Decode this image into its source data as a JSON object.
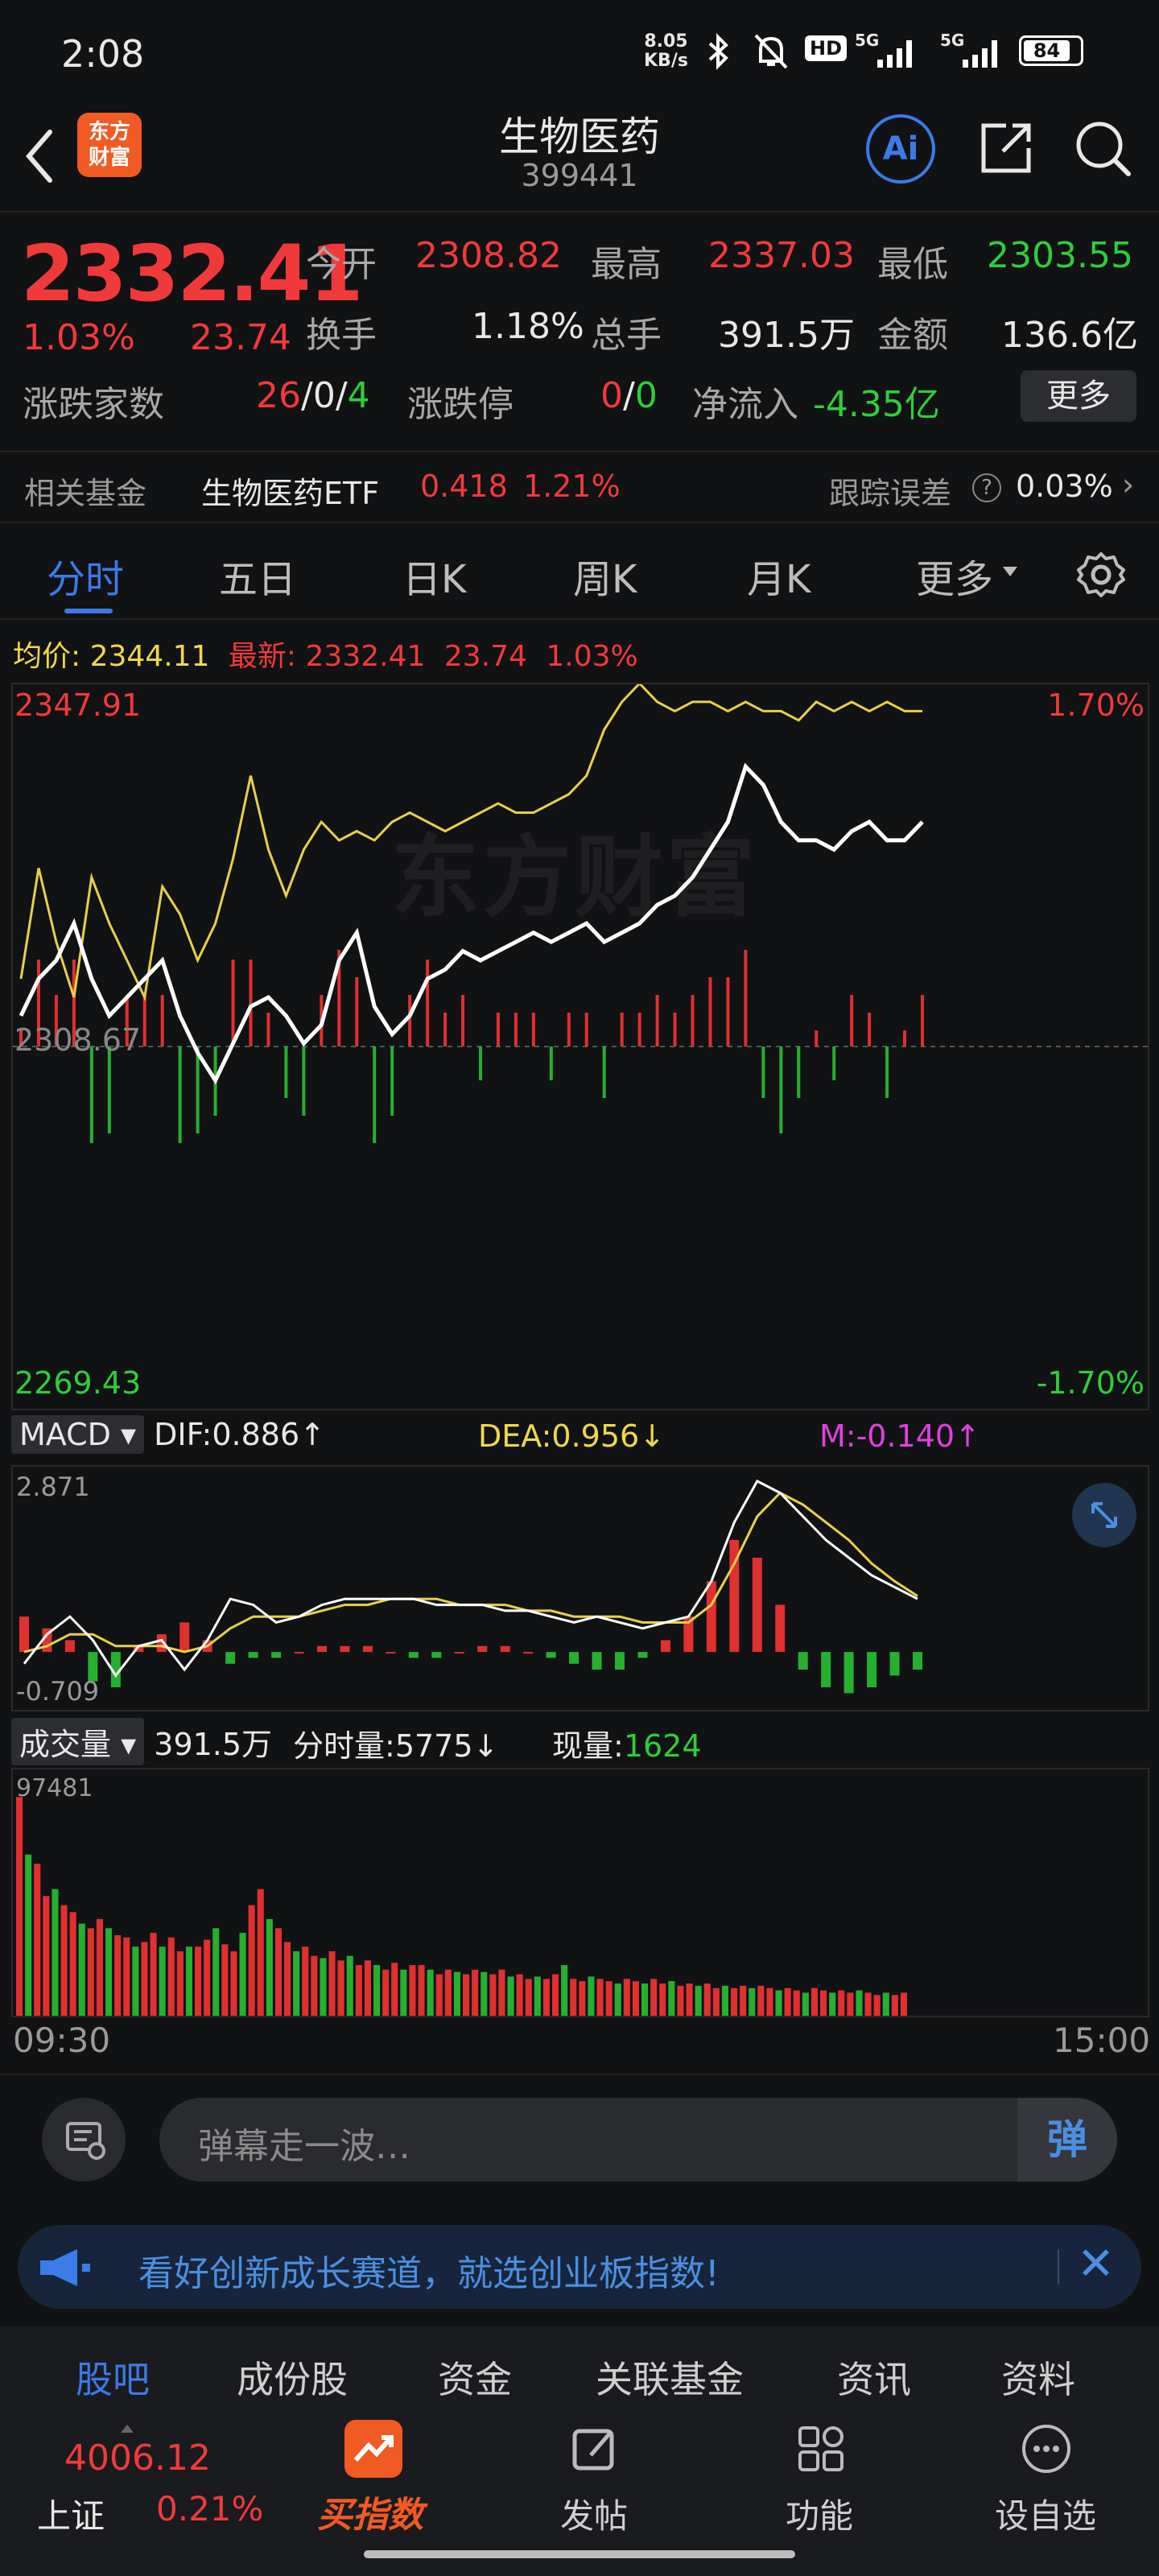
{
  "status": {
    "time": "2:08",
    "net_speed_top": "8.05",
    "net_speed_bot": "KB/s",
    "battery": "84",
    "signal1": "5G",
    "signal2": "5G",
    "hd": "HD"
  },
  "header": {
    "title": "生物医药",
    "code": "399441",
    "logo_line1": "东方",
    "logo_line2": "财富",
    "ai_label": "Ai"
  },
  "quote": {
    "price": "2332.41",
    "pct": "1.03%",
    "chg": "23.74",
    "open_label": "今开",
    "open": "2308.82",
    "high_label": "最高",
    "high": "2337.03",
    "low_label": "最低",
    "low": "2303.55",
    "turnover_label": "换手",
    "turnover": "1.18%",
    "vol_label": "总手",
    "vol": "391.5万",
    "amount_label": "金额",
    "amount": "136.6亿",
    "breadth_label": "涨跌家数",
    "up": "26",
    "flat": "0",
    "down": "4",
    "limit_label": "涨跌停",
    "limit_up": "0",
    "limit_down": "0",
    "netflow_label": "净流入",
    "netflow": "-4.35亿",
    "more_btn": "更多"
  },
  "fund": {
    "label": "相关基金",
    "name": "生物医药ETF",
    "price": "0.418",
    "pct": "1.21%",
    "track_label": "跟踪误差",
    "track": "0.03%"
  },
  "tabs": [
    "分时",
    "五日",
    "日K",
    "周K",
    "月K",
    "更多"
  ],
  "chart_header": {
    "avg_label": "均价:",
    "avg": "2344.11",
    "latest_label": "最新:",
    "latest": "2332.41",
    "chg": "23.74",
    "pct": "1.03%"
  },
  "chart_data": {
    "type": "line",
    "price_axis": {
      "top": "2347.91",
      "mid": "2308.67",
      "bottom": "2269.43",
      "top_pct": "1.70%",
      "bottom_pct": "-1.70%"
    },
    "price": [
      2312,
      2316,
      2318,
      2322,
      2316,
      2312,
      2314,
      2316,
      2318,
      2312,
      2308,
      2305,
      2309,
      2313,
      2314,
      2312,
      2309,
      2311,
      2318,
      2321,
      2313,
      2310,
      2312,
      2316,
      2317,
      2319,
      2318,
      2319,
      2320,
      2321,
      2320,
      2321,
      2322,
      2320,
      2321,
      2322,
      2324,
      2325,
      2327,
      2330,
      2333,
      2339,
      2337,
      2333,
      2331,
      2331,
      2330,
      2332,
      2333,
      2331,
      2331,
      2333
    ],
    "avg": [
      2316,
      2328,
      2320,
      2314,
      2327,
      2322,
      2318,
      2314,
      2326,
      2323,
      2318,
      2322,
      2329,
      2338,
      2330,
      2325,
      2330,
      2333,
      2331,
      2332,
      2331,
      2333,
      2334,
      2333,
      2332,
      2333,
      2334,
      2335,
      2334,
      2334,
      2335,
      2336,
      2338,
      2343,
      2346,
      2348,
      2346,
      2345,
      2346,
      2346,
      2345,
      2346,
      2345,
      2345,
      2344,
      2346,
      2345,
      2346,
      2345,
      2346,
      2345,
      2345
    ],
    "watermark": "东方财富",
    "macd": {
      "dif_label": "DIF:",
      "dif": "0.886",
      "dea_label": "DEA:",
      "dea": "0.956",
      "m_label": "M:",
      "m": "-0.140",
      "top": "2.871",
      "bottom": "-0.709",
      "name": "MACD",
      "dif_series": [
        -0.2,
        0.3,
        0.6,
        0.2,
        -0.4,
        0.1,
        0.2,
        -0.3,
        0.2,
        0.9,
        0.8,
        0.5,
        0.6,
        0.8,
        0.9,
        0.9,
        0.9,
        0.9,
        0.8,
        0.8,
        0.8,
        0.7,
        0.7,
        0.6,
        0.5,
        0.6,
        0.5,
        0.4,
        0.5,
        0.6,
        1.2,
        2.2,
        2.9,
        2.7,
        2.3,
        1.9,
        1.6,
        1.3,
        1.1,
        0.9
      ],
      "dea_series": [
        0,
        0.1,
        0.3,
        0.3,
        0.1,
        0.1,
        0.1,
        0.0,
        0.1,
        0.4,
        0.6,
        0.6,
        0.6,
        0.7,
        0.8,
        0.8,
        0.9,
        0.9,
        0.9,
        0.8,
        0.8,
        0.8,
        0.7,
        0.7,
        0.6,
        0.6,
        0.6,
        0.5,
        0.5,
        0.5,
        0.8,
        1.5,
        2.3,
        2.7,
        2.5,
        2.2,
        1.9,
        1.5,
        1.2,
        0.95
      ],
      "bars": [
        0.6,
        0.4,
        0.2,
        -0.5,
        -0.6,
        0.1,
        0.3,
        0.5,
        0.2,
        -0.2,
        -0.1,
        -0.1,
        0,
        0.1,
        0.1,
        0.1,
        0,
        -0.1,
        -0.1,
        0,
        0.1,
        0.1,
        0,
        -0.1,
        -0.2,
        -0.3,
        -0.3,
        -0.1,
        0.2,
        0.6,
        1.2,
        1.9,
        1.6,
        0.8,
        -0.3,
        -0.6,
        -0.7,
        -0.6,
        -0.4,
        -0.3
      ]
    },
    "volume": {
      "label": "成交量",
      "total": "391.5万",
      "fs_label": "分时量:",
      "fs": "5775",
      "now_label": "现量:",
      "now": "1624",
      "top": "97481",
      "bars": [
        95,
        70,
        66,
        52,
        55,
        48,
        45,
        40,
        38,
        42,
        38,
        35,
        34,
        30,
        32,
        36,
        30,
        34,
        28,
        30,
        30,
        33,
        38,
        31,
        28,
        36,
        48,
        55,
        42,
        38,
        32,
        28,
        30,
        26,
        25,
        28,
        24,
        26,
        22,
        24,
        22,
        20,
        23,
        20,
        22,
        22,
        20,
        18,
        20,
        19,
        18,
        20,
        19,
        18,
        20,
        17,
        18,
        16,
        17,
        16,
        18,
        22,
        16,
        15,
        17,
        16,
        15,
        14,
        16,
        15,
        14,
        16,
        14,
        15,
        13,
        14,
        13,
        14,
        12,
        13,
        12,
        13,
        12,
        13,
        12,
        11,
        12,
        11,
        10,
        12,
        11,
        10,
        11,
        10,
        11,
        10,
        9,
        10,
        9,
        10
      ],
      "colors": "rg"
    },
    "time_start": "09:30",
    "time_end": "15:00"
  },
  "danmaku": {
    "placeholder": "弹幕走一波…",
    "btn": "弹"
  },
  "banner": {
    "text": "看好创新成长赛道，就选创业板指数!"
  },
  "subtabs": [
    "股吧",
    "成份股",
    "资金",
    "关联基金",
    "资讯",
    "资料"
  ],
  "bottom": {
    "index_value": "4006.12",
    "index_name": "上证",
    "index_pct": "0.21%",
    "items": [
      "买指数",
      "发帖",
      "功能",
      "设自选"
    ]
  }
}
